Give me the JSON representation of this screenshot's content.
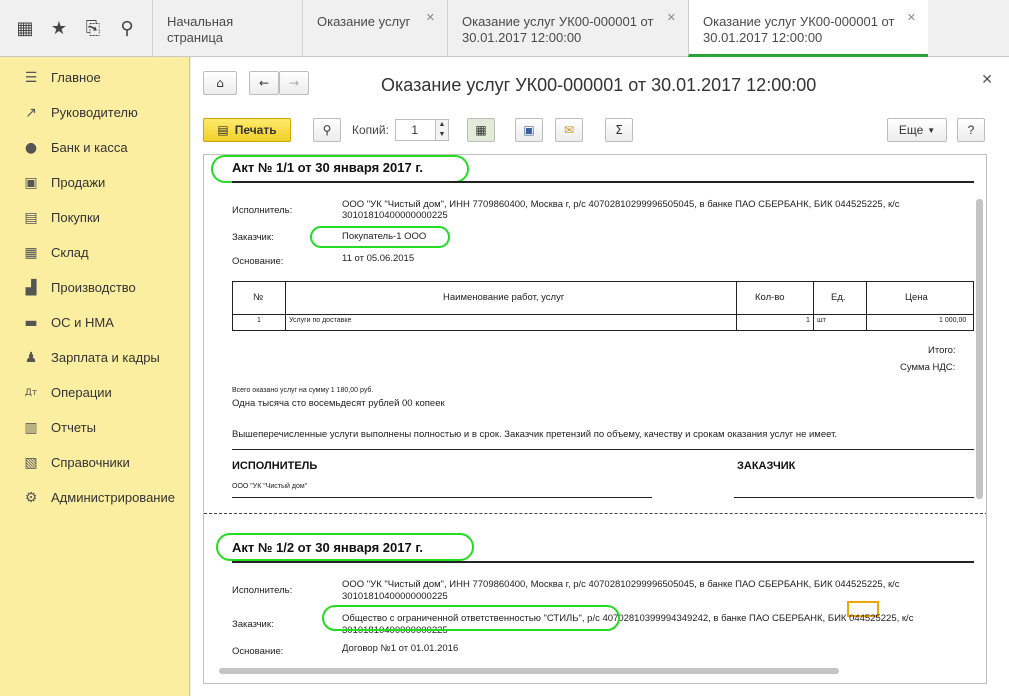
{
  "topbar": {
    "icons": [
      "apps-grid-icon",
      "star-icon",
      "history-icon",
      "search-icon"
    ],
    "tabs": [
      {
        "label": "Начальная страница",
        "closable": false
      },
      {
        "label": "Оказание услуг",
        "closable": true
      },
      {
        "label": "Оказание услуг УК00-000001 от 30.01.2017 12:00:00",
        "closable": true
      },
      {
        "label": "Оказание услуг УК00-000001 от 30.01.2017 12:00:00",
        "closable": true,
        "active": true
      }
    ]
  },
  "sidebar": {
    "items": [
      {
        "label": "Главное",
        "icon": "menu-lines-icon"
      },
      {
        "label": "Руководителю",
        "icon": "trend-up-icon"
      },
      {
        "label": "Банк и касса",
        "icon": "ruble-coin-icon"
      },
      {
        "label": "Продажи",
        "icon": "shopping-bag-icon"
      },
      {
        "label": "Покупки",
        "icon": "cart-icon"
      },
      {
        "label": "Склад",
        "icon": "warehouse-icon"
      },
      {
        "label": "Производство",
        "icon": "factory-icon"
      },
      {
        "label": "ОС и НМА",
        "icon": "truck-icon"
      },
      {
        "label": "Зарплата и кадры",
        "icon": "person-icon"
      },
      {
        "label": "Операции",
        "icon": "debit-credit-icon"
      },
      {
        "label": "Отчеты",
        "icon": "bar-chart-icon"
      },
      {
        "label": "Справочники",
        "icon": "books-icon"
      },
      {
        "label": "Администрирование",
        "icon": "gear-icon"
      }
    ]
  },
  "form": {
    "title": "Оказание услуг УК00-000001 от 30.01.2017 12:00:00",
    "print_label": "Печать",
    "copies_label": "Копий:",
    "copies_value": "1",
    "more_label": "Еще",
    "help_label": "?"
  },
  "act1": {
    "title": "Акт № 1/1 от 30 января 2017 г.",
    "executor_label": "Исполнитель:",
    "executor_value": "ООО \"УК \"Чистый дом\", ИНН 7709860400, Москва г, р/с 40702810299996505045, в банке ПАО СБЕРБАНК, БИК 044525225, к/с",
    "executor_value2": "30101810400000000225",
    "customer_label": "Заказчик:",
    "customer_value": "Покупатель-1 ООО",
    "basis_label": "Основание:",
    "basis_value": "11 от 05.06.2015",
    "table": {
      "headers": [
        "№",
        "Наименование работ, услуг",
        "Кол-во",
        "Ед.",
        "Цена"
      ],
      "rows": [
        [
          "1",
          "Услуги по доставке",
          "1",
          "шт",
          "1 000,00"
        ]
      ]
    },
    "total_label": "Итого:",
    "vat_label": "Сумма НДС:",
    "sum_text": "Всего оказано услуг на сумму 1 180,00 руб.",
    "sum_words": "Одна тысяча сто восемьдесят рублей 00 копеек",
    "note": "Вышеперечисленные услуги выполнены полностью и в срок. Заказчик претензий по объему, качеству и срокам оказания услуг не имеет.",
    "executor_caption": "ИСПОЛНИТЕЛЬ",
    "executor_name": "ООО \"УК \"Чистый дом\"",
    "customer_caption": "ЗАКАЗЧИК"
  },
  "act2": {
    "title": "Акт № 1/2 от 30 января 2017 г.",
    "executor_label": "Исполнитель:",
    "executor_value": "ООО \"УК \"Чистый дом\", ИНН 7709860400, Москва г, р/с 40702810299996505045, в банке ПАО СБЕРБАНК, БИК 044525225, к/с",
    "executor_value2": "30101810400000000225",
    "customer_label": "Заказчик:",
    "customer_value": "Общество с ограниченной ответственностью \"СТИЛЬ\", р/с 40702810399994349242, в банке ПАО СБЕРБАНК, БИК 044525225, к/с",
    "customer_value2": "30101810400000000225",
    "basis_label": "Основание:",
    "basis_value": "Договор №1 от 01.01.2016"
  }
}
